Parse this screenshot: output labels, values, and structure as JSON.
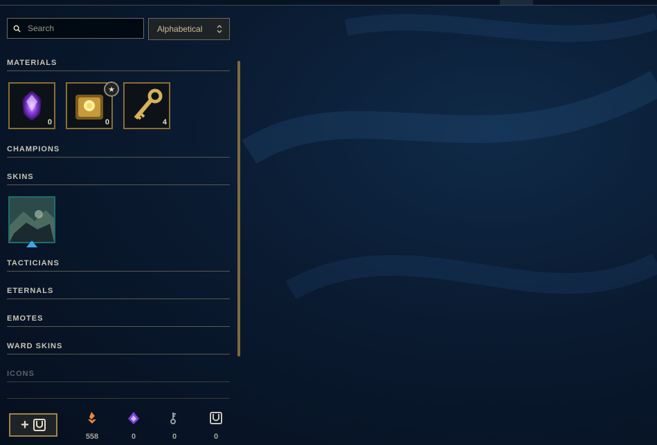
{
  "search": {
    "placeholder": "Search"
  },
  "sort": {
    "selected": "Alphabetical"
  },
  "sections": {
    "materials": "MATERIALS",
    "champions": "CHAMPIONS",
    "skins": "SKINS",
    "tacticians": "TACTICIANS",
    "eternals": "ETERNALS",
    "emotes": "EMOTES",
    "ward_skins": "WARD SKINS",
    "icons": "ICONS"
  },
  "materials": [
    {
      "icon": "purple-gem-icon",
      "count": "0"
    },
    {
      "icon": "hextech-chest-icon",
      "count": "0"
    },
    {
      "icon": "key-icon",
      "count": "4"
    }
  ],
  "badge": {
    "icon": "star-icon",
    "glyph": "★"
  },
  "skins": [
    {
      "icon": "skin-shard-icon"
    }
  ],
  "craft_button": {
    "plus": "+"
  },
  "currencies": [
    {
      "icon": "orange-essence-icon",
      "count": "558",
      "color": "#f0883a"
    },
    {
      "icon": "mythic-essence-icon",
      "count": "0",
      "color": "#b07cff"
    },
    {
      "icon": "key-fragment-icon",
      "count": "0",
      "color": "#9aa0a6"
    },
    {
      "icon": "chest-icon",
      "count": "0",
      "color": "#c8c6b6"
    }
  ],
  "colors": {
    "gold": "#c8aa6e",
    "border": "#8b6d33",
    "bg": "#0a1a30"
  }
}
